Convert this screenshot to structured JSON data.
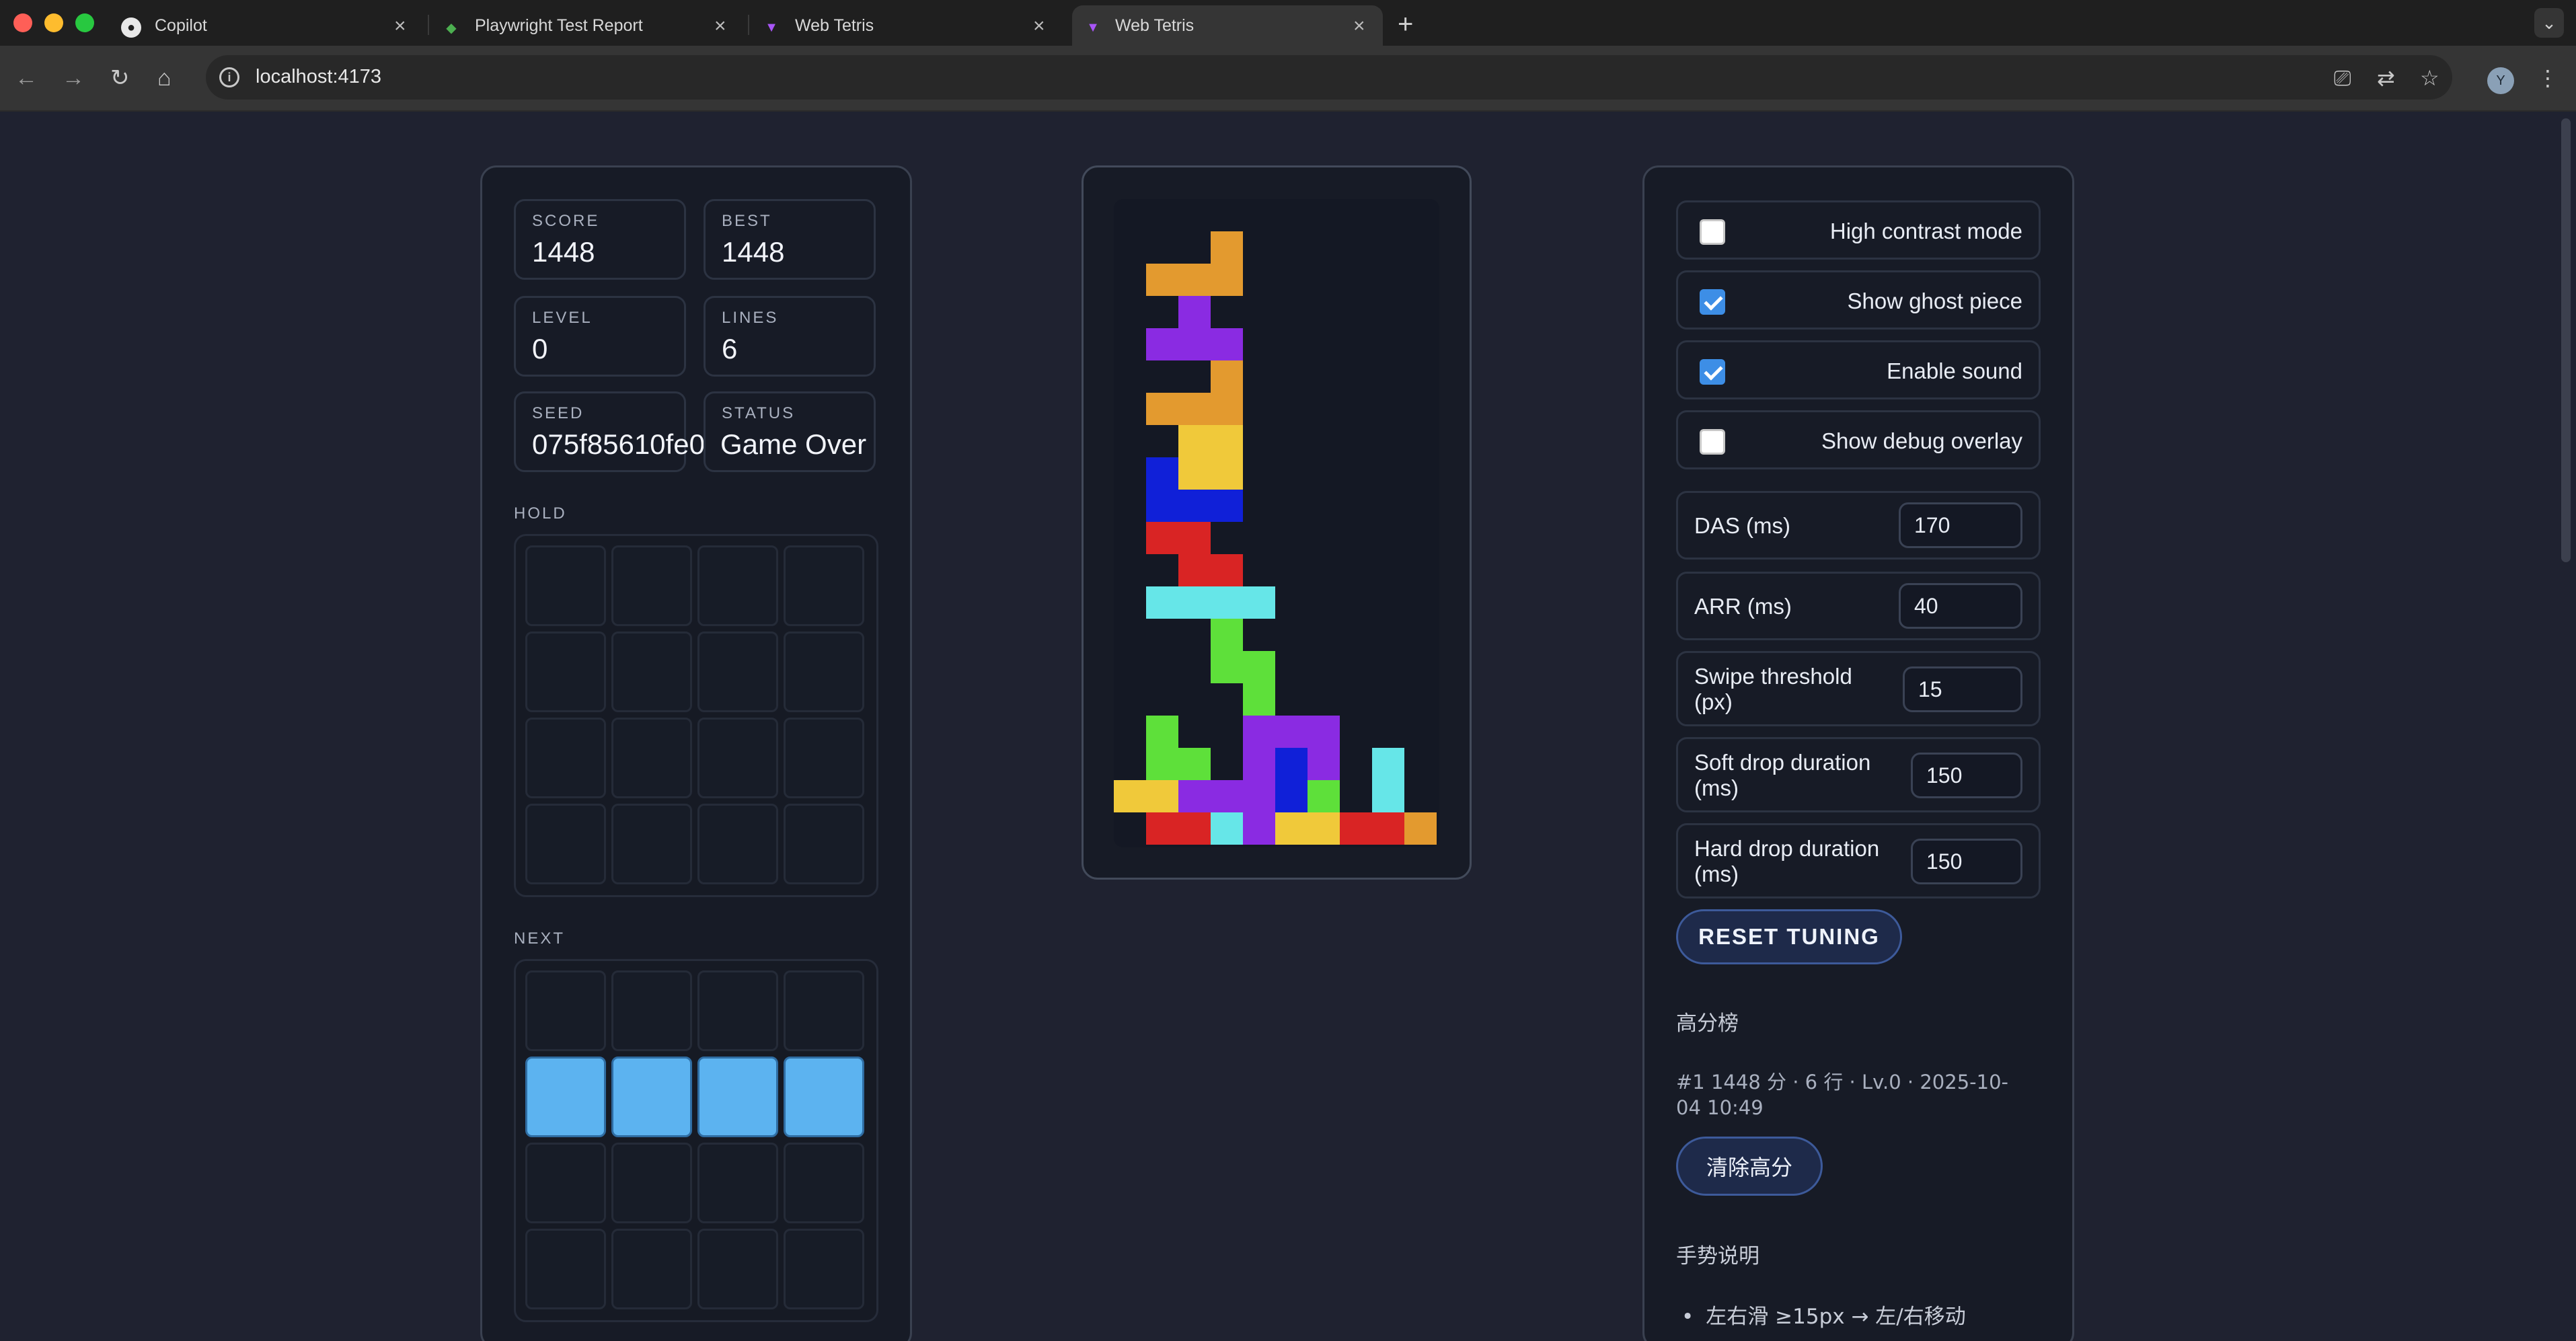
{
  "browser": {
    "tabs": [
      {
        "title": "Copilot",
        "icon": "github-icon"
      },
      {
        "title": "Playwright Test Report",
        "icon": "playwright-icon"
      },
      {
        "title": "Web Tetris",
        "icon": "vite-icon"
      },
      {
        "title": "Web Tetris",
        "icon": "vite-icon",
        "active": true
      }
    ],
    "url": "localhost:4173",
    "profile_initial": "Y"
  },
  "stats": {
    "score_label": "SCORE",
    "score": "1448",
    "best_label": "BEST",
    "best": "1448",
    "level_label": "LEVEL",
    "level": "0",
    "lines_label": "LINES",
    "lines": "6",
    "seed_label": "SEED",
    "seed": "075f85610fe0",
    "status_label": "STATUS",
    "status": "Game Over"
  },
  "hold": {
    "label": "HOLD"
  },
  "next": {
    "label": "NEXT",
    "piece": "I",
    "piece_color": "#5cb3f0"
  },
  "board": {
    "columns": 10,
    "rows": 20,
    "colors": {
      "O": "#f0c93a",
      "L": "#e39a2f",
      "T": "#8a2be2",
      "J": "#1020d8",
      "Z": "#d92424",
      "I": "#66e6e8",
      "S": "#5ee03a"
    },
    "cells": [
      {
        "r": 1,
        "c": 3,
        "p": "L"
      },
      {
        "r": 2,
        "c": 1,
        "p": "L"
      },
      {
        "r": 2,
        "c": 2,
        "p": "L"
      },
      {
        "r": 2,
        "c": 3,
        "p": "L"
      },
      {
        "r": 3,
        "c": 2,
        "p": "T"
      },
      {
        "r": 4,
        "c": 1,
        "p": "T"
      },
      {
        "r": 4,
        "c": 2,
        "p": "T"
      },
      {
        "r": 4,
        "c": 3,
        "p": "T"
      },
      {
        "r": 5,
        "c": 3,
        "p": "L"
      },
      {
        "r": 6,
        "c": 1,
        "p": "L"
      },
      {
        "r": 6,
        "c": 2,
        "p": "L"
      },
      {
        "r": 6,
        "c": 3,
        "p": "L"
      },
      {
        "r": 7,
        "c": 2,
        "p": "O"
      },
      {
        "r": 7,
        "c": 3,
        "p": "O"
      },
      {
        "r": 8,
        "c": 1,
        "p": "J"
      },
      {
        "r": 8,
        "c": 2,
        "p": "O"
      },
      {
        "r": 8,
        "c": 3,
        "p": "O"
      },
      {
        "r": 9,
        "c": 1,
        "p": "J"
      },
      {
        "r": 9,
        "c": 2,
        "p": "J"
      },
      {
        "r": 9,
        "c": 3,
        "p": "J"
      },
      {
        "r": 10,
        "c": 1,
        "p": "Z"
      },
      {
        "r": 10,
        "c": 2,
        "p": "Z"
      },
      {
        "r": 11,
        "c": 2,
        "p": "Z"
      },
      {
        "r": 11,
        "c": 3,
        "p": "Z"
      },
      {
        "r": 12,
        "c": 1,
        "p": "I"
      },
      {
        "r": 12,
        "c": 2,
        "p": "I"
      },
      {
        "r": 12,
        "c": 3,
        "p": "I"
      },
      {
        "r": 12,
        "c": 4,
        "p": "I"
      },
      {
        "r": 13,
        "c": 3,
        "p": "S"
      },
      {
        "r": 14,
        "c": 3,
        "p": "S"
      },
      {
        "r": 14,
        "c": 4,
        "p": "S"
      },
      {
        "r": 15,
        "c": 4,
        "p": "S"
      },
      {
        "r": 16,
        "c": 1,
        "p": "S"
      },
      {
        "r": 16,
        "c": 4,
        "p": "T"
      },
      {
        "r": 16,
        "c": 5,
        "p": "T"
      },
      {
        "r": 16,
        "c": 6,
        "p": "T"
      },
      {
        "r": 17,
        "c": 1,
        "p": "S"
      },
      {
        "r": 17,
        "c": 2,
        "p": "S"
      },
      {
        "r": 17,
        "c": 4,
        "p": "T"
      },
      {
        "r": 17,
        "c": 5,
        "p": "J"
      },
      {
        "r": 17,
        "c": 6,
        "p": "T"
      },
      {
        "r": 17,
        "c": 8,
        "p": "I"
      },
      {
        "r": 18,
        "c": 0,
        "p": "O"
      },
      {
        "r": 18,
        "c": 1,
        "p": "O"
      },
      {
        "r": 18,
        "c": 2,
        "p": "T"
      },
      {
        "r": 18,
        "c": 3,
        "p": "T"
      },
      {
        "r": 18,
        "c": 4,
        "p": "T"
      },
      {
        "r": 18,
        "c": 5,
        "p": "J"
      },
      {
        "r": 18,
        "c": 6,
        "p": "S"
      },
      {
        "r": 18,
        "c": 8,
        "p": "I"
      },
      {
        "r": 19,
        "c": 1,
        "p": "Z"
      },
      {
        "r": 19,
        "c": 2,
        "p": "Z"
      },
      {
        "r": 19,
        "c": 3,
        "p": "I"
      },
      {
        "r": 19,
        "c": 4,
        "p": "T"
      },
      {
        "r": 19,
        "c": 5,
        "p": "O"
      },
      {
        "r": 19,
        "c": 6,
        "p": "O"
      },
      {
        "r": 19,
        "c": 7,
        "p": "Z"
      },
      {
        "r": 19,
        "c": 8,
        "p": "Z"
      },
      {
        "r": 19,
        "c": 9,
        "p": "L"
      }
    ]
  },
  "settings": {
    "toggles": [
      {
        "label": "High contrast mode",
        "checked": false
      },
      {
        "label": "Show ghost piece",
        "checked": true
      },
      {
        "label": "Enable sound",
        "checked": true
      },
      {
        "label": "Show debug overlay",
        "checked": false
      }
    ],
    "das_label": "DAS (ms)",
    "das": "170",
    "arr_label": "ARR (ms)",
    "arr": "40",
    "swipe_label": "Swipe threshold (px)",
    "swipe": "15",
    "soft_label": "Soft drop duration (ms)",
    "soft": "150",
    "hard_label": "Hard drop duration (ms)",
    "hard": "150",
    "reset_label": "RESET TUNING"
  },
  "leaderboard": {
    "title": "高分榜",
    "entry": "#1 1448 分 · 6 行 · Lv.0 · 2025-10-04 10:49",
    "clear_label": "清除高分"
  },
  "gestures": {
    "title": "手势说明",
    "items": [
      "左右滑 ≥15px → 左/右移动"
    ]
  }
}
